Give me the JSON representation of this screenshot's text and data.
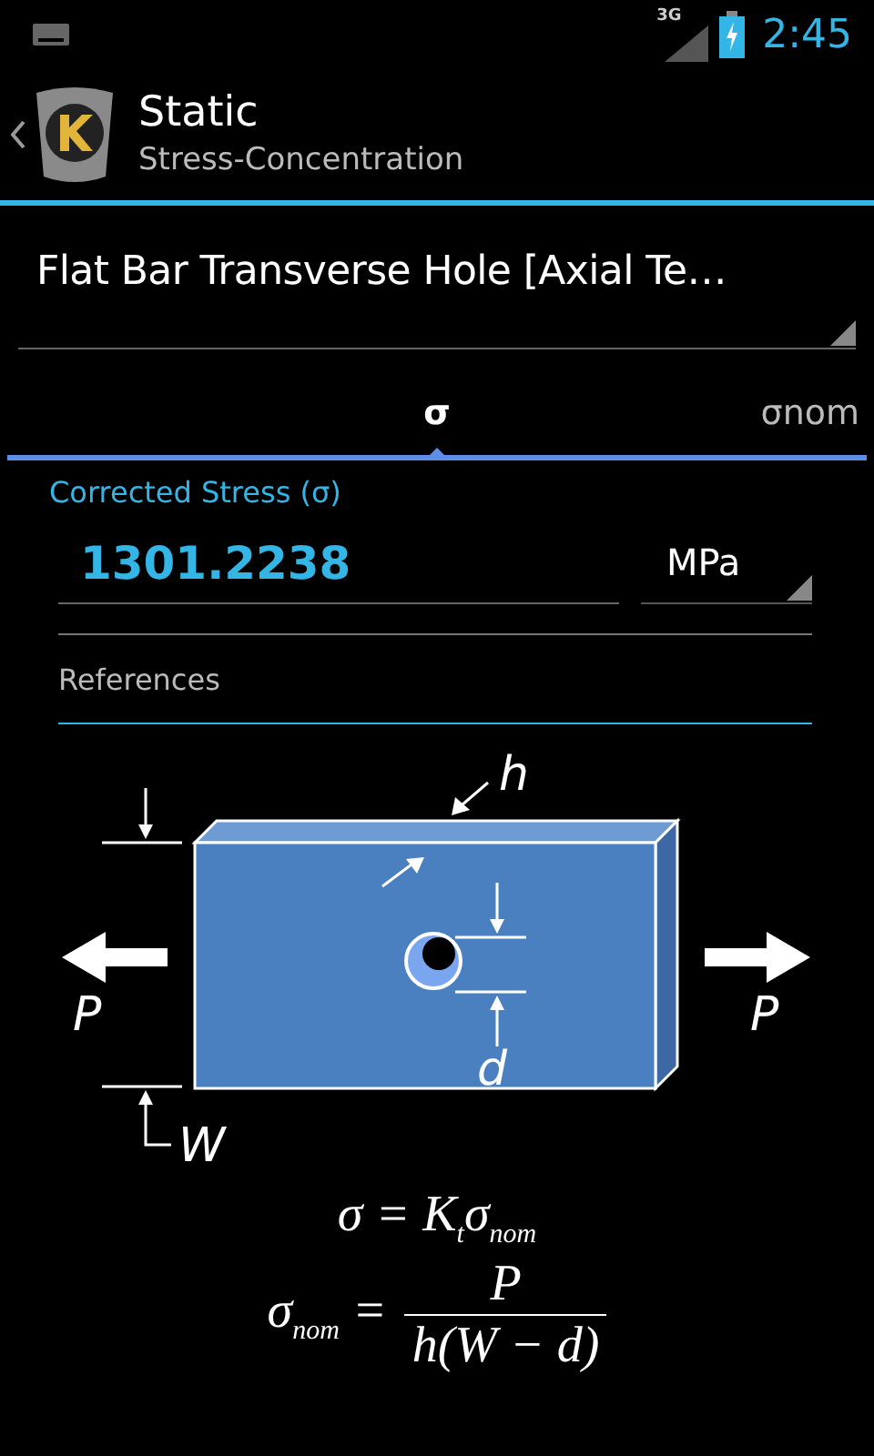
{
  "status_bar": {
    "network": "3G",
    "time": "2:45"
  },
  "action_bar": {
    "title": "Static",
    "subtitle": "Stress-Concentration"
  },
  "case_spinner": {
    "value": "Flat Bar Transverse Hole [Axial Te…"
  },
  "tabs": [
    {
      "label": "σ",
      "selected": true
    },
    {
      "label": "σnom",
      "selected": false
    }
  ],
  "result": {
    "label": "Corrected Stress (σ)",
    "value": "1301.2238",
    "unit": "MPa"
  },
  "references": {
    "label": "References"
  },
  "diagram": {
    "labels": {
      "h": "h",
      "d": "d",
      "w": "W",
      "p_left": "P",
      "p_right": "P"
    },
    "formula_1": "σ = K$_{t}$σ$_{nom}$",
    "formula_2": {
      "left": "σ$_{nom}$ =",
      "numerator": "P",
      "denominator": "h(W − d)"
    }
  }
}
